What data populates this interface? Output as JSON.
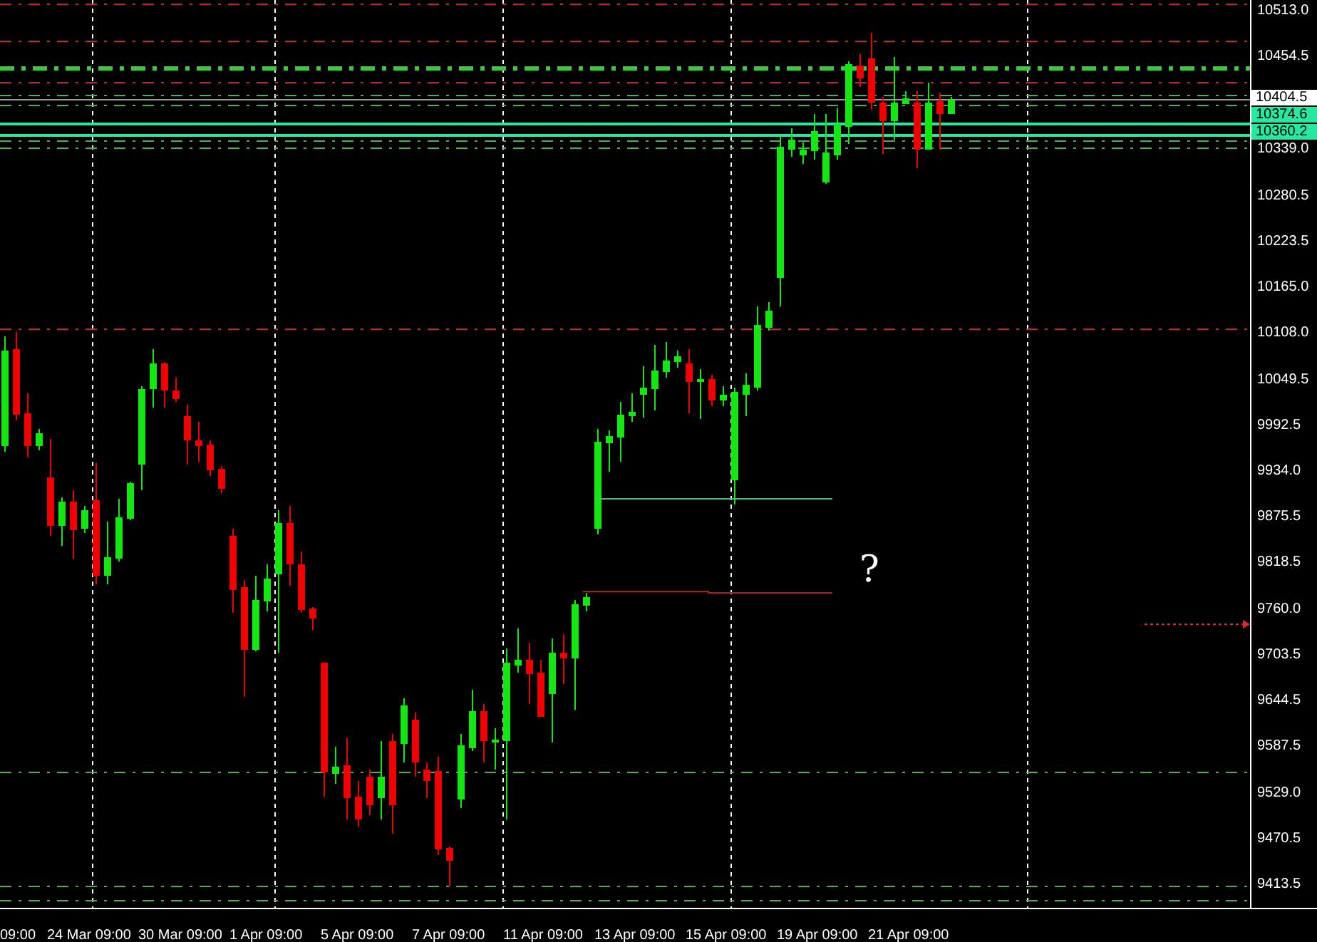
{
  "chart": {
    "annotation": "?"
  },
  "price_axis": [
    {
      "kind": "label",
      "text": "10513.0"
    },
    {
      "kind": "label",
      "text": "10454.5"
    },
    {
      "kind": "tags",
      "tags": [
        {
          "text": "10404.5",
          "color": "#ffffff"
        },
        {
          "text": "10374.6",
          "color": "#27e8a0"
        },
        {
          "text": "10360.2",
          "color": "#27e8a0"
        }
      ]
    },
    {
      "kind": "label",
      "text": "10339.0"
    },
    {
      "kind": "label",
      "text": "10280.5"
    },
    {
      "kind": "label",
      "text": "10223.5"
    },
    {
      "kind": "label",
      "text": "10165.0"
    },
    {
      "kind": "label",
      "text": "10108.0"
    },
    {
      "kind": "label",
      "text": "10049.5"
    },
    {
      "kind": "label",
      "text": "9992.5"
    },
    {
      "kind": "label",
      "text": "9934.0"
    },
    {
      "kind": "label",
      "text": "9875.5"
    },
    {
      "kind": "label",
      "text": "9818.5"
    },
    {
      "kind": "label",
      "text": "9760.0"
    },
    {
      "kind": "label",
      "text": "9703.5"
    },
    {
      "kind": "label",
      "text": "9644.5"
    },
    {
      "kind": "label",
      "text": "9587.5"
    },
    {
      "kind": "label",
      "text": "9529.0"
    },
    {
      "kind": "label",
      "text": "9470.5"
    },
    {
      "kind": "label",
      "text": "9413.5"
    }
  ],
  "time_axis": [
    "09:00",
    "24 Mar 09:00",
    "30 Mar 09:00",
    "1 Apr 09:00",
    "5 Apr 09:00",
    "7 Apr 09:00",
    "11 Apr 09:00",
    "13 Apr 09:00",
    "15 Apr 09:00",
    "19 Apr 09:00",
    "21 Apr 09:00"
  ]
}
